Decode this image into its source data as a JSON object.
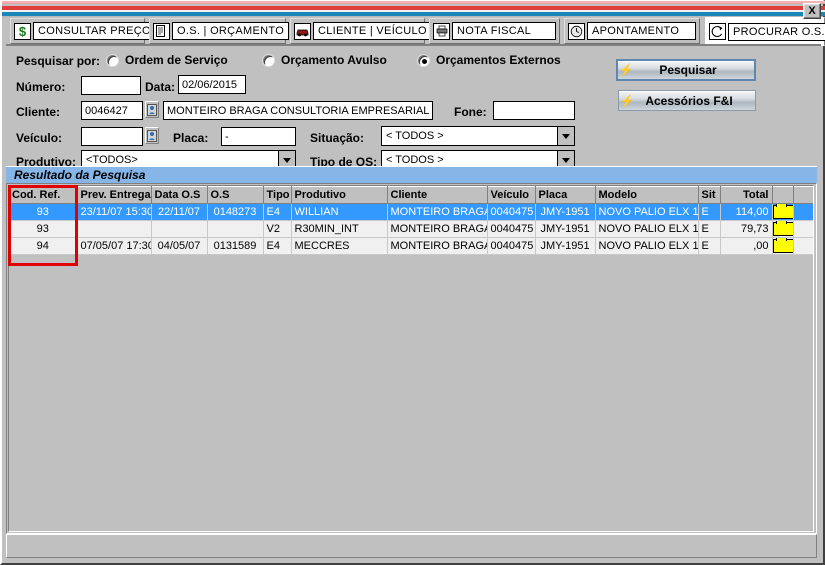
{
  "window": {
    "close_label": "X"
  },
  "tabs": [
    {
      "label": "CONSULTAR PREÇO",
      "icon": "dollar-icon",
      "icon_glyph": "$",
      "icon_color": "#1a7a1a",
      "active": false
    },
    {
      "label": "O.S. | ORÇAMENTO",
      "icon": "document-icon",
      "icon_glyph": "▤",
      "icon_color": "#333333",
      "active": false
    },
    {
      "label": "CLIENTE | VEÍCULO",
      "icon": "car-icon",
      "icon_glyph": "⛟",
      "icon_color": "#8b1a1a",
      "active": false
    },
    {
      "label": "NOTA FISCAL",
      "icon": "printer-icon",
      "icon_glyph": "🖶",
      "icon_color": "#333333",
      "active": false
    },
    {
      "label": "APONTAMENTO",
      "icon": "clock-icon",
      "icon_glyph": "◴",
      "icon_color": "#333333",
      "active": false
    },
    {
      "label": "PROCURAR O.S.",
      "icon": "search-os-icon",
      "icon_glyph": "↻",
      "icon_color": "#333333",
      "active": true
    }
  ],
  "search": {
    "search_by_label": "Pesquisar por:",
    "options": [
      {
        "label": "Ordem de Serviço",
        "selected": false
      },
      {
        "label": "Orçamento Avulso",
        "selected": false
      },
      {
        "label": "Orçamentos Externos",
        "selected": true
      }
    ],
    "numero_label": "Número:",
    "numero_value": "",
    "data_label": "Data:",
    "data_value": "02/06/2015",
    "cliente_label": "Cliente:",
    "cliente_code": "0046427",
    "cliente_name": "MONTEIRO BRAGA CONSULTORIA EMPRESARIAL LTDA",
    "fone_label": "Fone:",
    "fone_value": "",
    "veiculo_label": "Veículo:",
    "veiculo_value": "",
    "placa_label": "Placa:",
    "placa_value": "-",
    "situacao_label": "Situação:",
    "situacao_value": "< TODOS >",
    "produtivo_label": "Produtivo:",
    "produtivo_value": "<TODOS>",
    "tipo_os_label": "Tipo de OS:",
    "tipo_os_value": "< TODOS >"
  },
  "actions": {
    "pesquisar_label": "Pesquisar",
    "acessorios_label": "Acessórios F&I",
    "bolt_glyph": "⚡"
  },
  "results": {
    "title": "Resultado da Pesquisa",
    "columns": [
      "Cod. Ref.",
      "Prev. Entrega",
      "Data O.S",
      "O.S",
      "Tipo",
      "Produtivo",
      "Cliente",
      "Veículo",
      "Placa",
      "Modelo",
      "Sit",
      "Total",
      "",
      ""
    ],
    "rows": [
      {
        "selected": true,
        "cod_ref": "93",
        "prev_entrega": "23/11/07 15:30",
        "data_os": "22/11/07",
        "os": "0148273",
        "tipo": "E4",
        "produtivo": "WILLIAN",
        "cliente": "MONTEIRO BRAGA C",
        "veiculo": "0040475",
        "placa": "JMY-1951",
        "modelo": "NOVO PALIO ELX 1",
        "sit": "E",
        "total": "114,00"
      },
      {
        "selected": false,
        "cod_ref": "93",
        "prev_entrega": "",
        "data_os": "",
        "os": "",
        "tipo": "V2",
        "produtivo": "R30MIN_INT",
        "cliente": "MONTEIRO BRAGA C",
        "veiculo": "0040475",
        "placa": "JMY-1951",
        "modelo": "NOVO PALIO ELX 1",
        "sit": "E",
        "total": "79,73"
      },
      {
        "selected": false,
        "cod_ref": "94",
        "prev_entrega": "07/05/07 17:30",
        "data_os": "04/05/07",
        "os": "0131589",
        "tipo": "E4",
        "produtivo": "MECCRES",
        "cliente": "MONTEIRO BRAGA C",
        "veiculo": "0040475",
        "placa": "JMY-1951",
        "modelo": "NOVO PALIO ELX 1",
        "sit": "E",
        "total": ",00"
      }
    ]
  },
  "colors": {
    "selection": "#3399ff",
    "header_band": "#86b5e8",
    "highlight_box": "#e00000",
    "folder": "#ffff00",
    "face": "#c0c0c0"
  }
}
